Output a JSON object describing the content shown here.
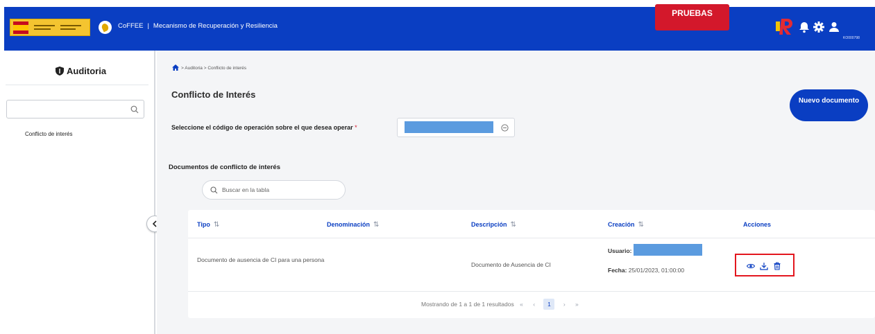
{
  "header": {
    "app_name": "CoFFEE",
    "separator": "|",
    "subtitle": "Mecanismo de Recuperación y Resiliencia",
    "env_badge": "PRUEBAS",
    "user_code": "KO000798"
  },
  "sidebar": {
    "title": "Auditoria",
    "search_placeholder": "",
    "items": [
      {
        "label": "Conflicto de interés"
      }
    ]
  },
  "breadcrumb": {
    "items": [
      "Auditoria",
      "Conflicto de interés"
    ],
    "separator": ">"
  },
  "page": {
    "title": "Conflicto de Interés",
    "new_button": "Nuevo documento",
    "operation_label": "Seleccione el código de operación sobre el que desea operar",
    "required_mark": "*",
    "docs_title": "Documentos de conflicto de interés",
    "table_search_placeholder": "Buscar en la tabla"
  },
  "table": {
    "columns": [
      "Tipo",
      "Denominación",
      "Descripción",
      "Creación",
      "Acciones"
    ],
    "sort_glyph": "⇅",
    "rows": [
      {
        "tipo": "Documento de ausencia de CI para una persona",
        "denominacion": "",
        "descripcion": "Documento de Ausencia de CI",
        "usuario_label": "Usuario:",
        "fecha_label": "Fecha:",
        "fecha_value": "25/01/2023, 01:00:00",
        "actions": [
          "eye-icon",
          "download-icon",
          "trash-icon"
        ]
      }
    ],
    "pagination": {
      "summary": "Mostrando de 1 a 1 de 1 resultados",
      "first": "«",
      "prev": "‹",
      "current": "1",
      "next": "›",
      "last": "»"
    }
  },
  "colors": {
    "primary": "#0a3ec2",
    "badge": "#d3182b",
    "redaction": "#5b9bdf",
    "highlight": "#e3161e"
  }
}
